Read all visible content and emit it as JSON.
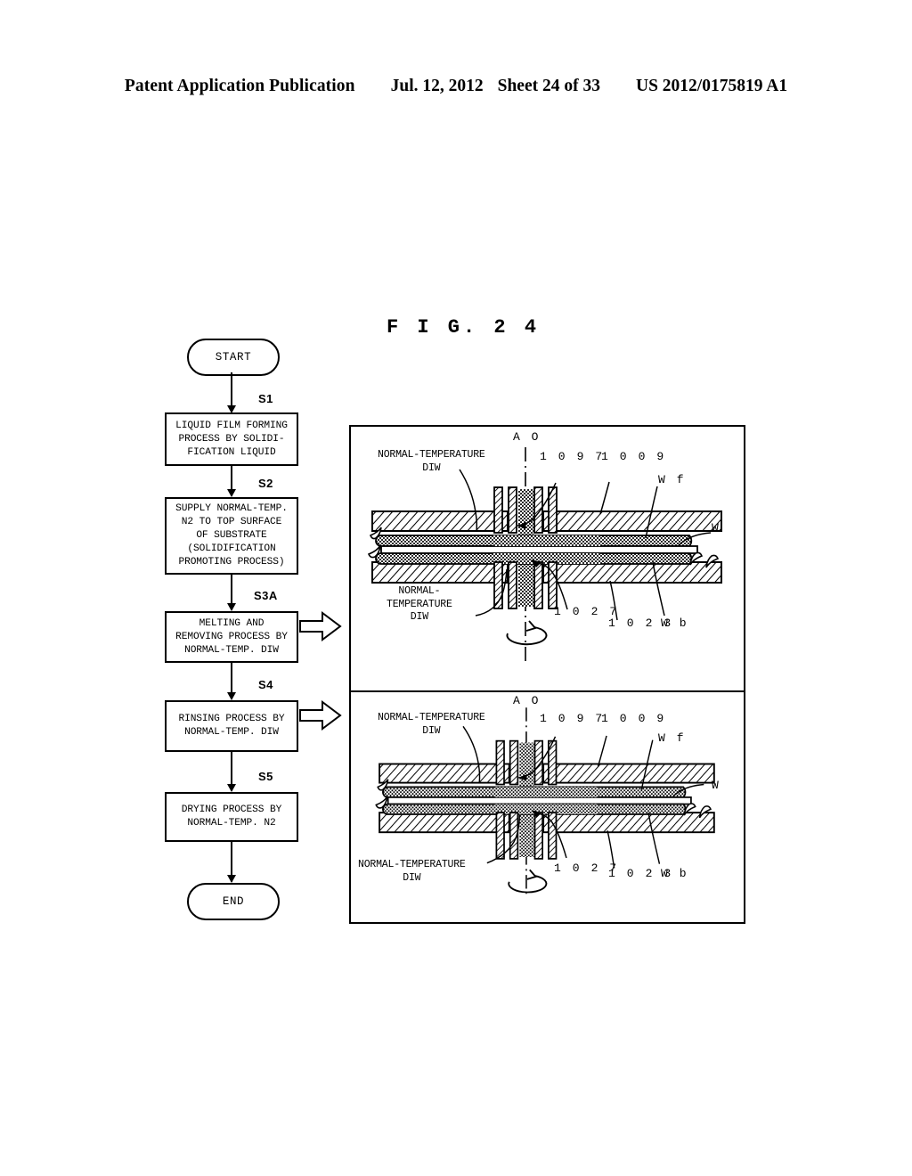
{
  "header": {
    "publication": "Patent Application Publication",
    "date": "Jul. 12, 2012",
    "sheet": "Sheet 24 of 33",
    "patent_number": "US 2012/0175819 A1"
  },
  "figure": {
    "title": "F I G.  2 4"
  },
  "flowchart": {
    "start_label": "START",
    "end_label": "END",
    "steps": [
      {
        "id": "S1",
        "lines": [
          "LIQUID FILM FORMING",
          "PROCESS BY SOLIDI-",
          "FICATION LIQUID"
        ]
      },
      {
        "id": "S2",
        "lines": [
          "SUPPLY NORMAL-TEMP.",
          "N2 TO TOP SURFACE",
          "OF SUBSTRATE",
          "(SOLIDIFICATION",
          "PROMOTING PROCESS)"
        ]
      },
      {
        "id": "S3A",
        "lines": [
          "MELTING AND",
          "REMOVING PROCESS BY",
          "NORMAL-TEMP. DIW"
        ]
      },
      {
        "id": "S4",
        "lines": [
          "RINSING PROCESS BY",
          "NORMAL-TEMP. DIW"
        ]
      },
      {
        "id": "S5",
        "lines": [
          "DRYING PROCESS BY",
          "NORMAL-TEMP. N2"
        ]
      }
    ]
  },
  "panels": [
    {
      "name": "melting-removing-panel",
      "axis_label": "A O",
      "top_left_label": [
        "NORMAL-TEMPERATURE",
        "DIW"
      ],
      "bottom_left_label": [
        "NORMAL-",
        "TEMPERATURE",
        "DIW"
      ],
      "numerals": {
        "top_nozzle": "1 0 9 7",
        "top_plate": "1 0 0 9",
        "bottom_nozzle": "1 0 2 7",
        "bottom_plate": "1 0 2 3"
      },
      "part_labels": {
        "front_surface": "W f",
        "substrate": "W",
        "back_surface": "W b"
      }
    },
    {
      "name": "rinsing-panel",
      "axis_label": "A O",
      "top_left_label": [
        "NORMAL-TEMPERATURE",
        "DIW"
      ],
      "bottom_left_label": [
        "NORMAL-TEMPERATURE",
        "DIW"
      ],
      "numerals": {
        "top_nozzle": "1 0 9 7",
        "top_plate": "1 0 0 9",
        "bottom_nozzle": "1 0 2 7",
        "bottom_plate": "1 0 2 3"
      },
      "part_labels": {
        "front_surface": "W f",
        "substrate": "W",
        "back_surface": "W b"
      }
    }
  ],
  "colors": {
    "ink": "#000000",
    "paper": "#ffffff"
  }
}
